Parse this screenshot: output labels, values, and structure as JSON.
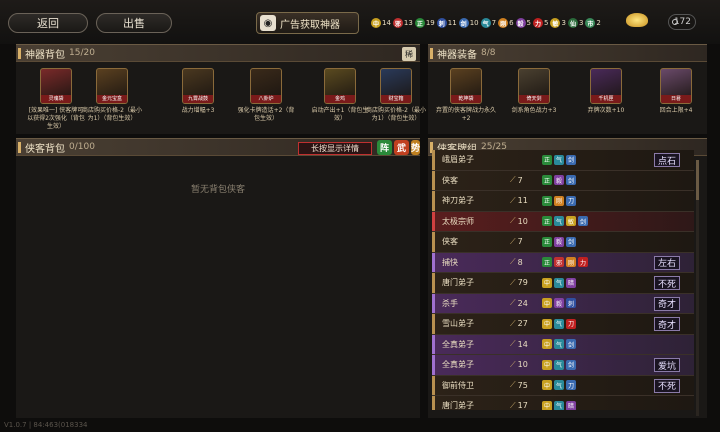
{
  "topbar": {
    "back_label": "返回",
    "sell_label": "出售",
    "ad_label": "广告获取神器",
    "time": "172",
    "resources": [
      {
        "icon": "中",
        "color": "#c8a020",
        "value": "14"
      },
      {
        "icon": "邪",
        "color": "#c03030",
        "value": "13"
      },
      {
        "icon": "正",
        "color": "#2a8a3a",
        "value": "19"
      },
      {
        "icon": "刺",
        "color": "#3050a0",
        "value": "11"
      },
      {
        "icon": "剑",
        "color": "#3a6ab0",
        "value": "10"
      },
      {
        "icon": "气",
        "color": "#2a8a9a",
        "value": "7"
      },
      {
        "icon": "刚",
        "color": "#d08020",
        "value": "6"
      },
      {
        "icon": "毅",
        "color": "#8040a0",
        "value": "5"
      },
      {
        "icon": "力",
        "color": "#c02020",
        "value": "5"
      },
      {
        "icon": "敏",
        "color": "#c8a020",
        "value": "3"
      },
      {
        "icon": "仙",
        "color": "#2a6a3a",
        "value": "3"
      },
      {
        "icon": "市",
        "color": "#3a8a5a",
        "value": "2"
      }
    ]
  },
  "bag": {
    "title": "神器背包",
    "count": "15/20",
    "badge": "稀",
    "items": [
      {
        "name": "灵魂袋",
        "desc": "[效果唯一] 侠客牌可以获得2次强化（背包生效）",
        "color": "#7a2a2a"
      },
      {
        "name": "金元宝盒",
        "desc": "商店购买价格-2（最小为1）（背包生效）",
        "color": "#5a4020"
      },
      {
        "name": "九霄战鼓",
        "desc": "战力增幅+3",
        "color": "#4a3820"
      },
      {
        "name": "八卦炉",
        "desc": "强化卡牌造话+2（背包生效）",
        "color": "#3a2a1a"
      },
      {
        "name": "金鸡",
        "desc": "启动产出+1（背包生效）",
        "color": "#5a4a20"
      },
      {
        "name": "财宝箱",
        "desc": "商店购买价格-2（最小为1）（背包生效）",
        "color": "#2a3a5a"
      }
    ]
  },
  "equip": {
    "title": "神器装备",
    "count": "8/8",
    "items": [
      {
        "name": "乾坤袋",
        "desc": "弃置的侠客牌战力永久+2",
        "color": "#5a4020"
      },
      {
        "name": "倚天剑",
        "desc": "剑系角色战力+3",
        "color": "#4a4030"
      },
      {
        "name": "千机匣",
        "desc": "弃牌次数+10",
        "color": "#4a2a5a"
      },
      {
        "name": "日晷",
        "desc": "回合上限+4",
        "color": "#6a4a6a"
      }
    ]
  },
  "hero_bag": {
    "title": "侠客背包",
    "count": "0/100",
    "detail_label": "长按显示详情",
    "sorts": [
      {
        "label": "阵",
        "color": "#2a8a3a"
      },
      {
        "label": "武",
        "color": "#c04020"
      },
      {
        "label": "势",
        "color": "#c08020"
      }
    ],
    "empty_text": "暂无背包侠客"
  },
  "deck": {
    "title": "侠客牌组",
    "count": "25/25",
    "rows": [
      {
        "name": "峨眉弟子",
        "atk": "",
        "style": "",
        "tags": [
          {
            "t": "正",
            "c": "#2a8a3a"
          },
          {
            "t": "气",
            "c": "#2a8a9a"
          },
          {
            "t": "剑",
            "c": "#3a6ab0"
          }
        ],
        "mark": "点石"
      },
      {
        "name": "侠客",
        "atk": "7",
        "style": "",
        "tags": [
          {
            "t": "正",
            "c": "#2a8a3a"
          },
          {
            "t": "毅",
            "c": "#8040a0"
          },
          {
            "t": "剑",
            "c": "#3a6ab0"
          }
        ],
        "mark": ""
      },
      {
        "name": "神刀弟子",
        "atk": "11",
        "style": "",
        "tags": [
          {
            "t": "正",
            "c": "#2a8a3a"
          },
          {
            "t": "刚",
            "c": "#d08020"
          },
          {
            "t": "刀",
            "c": "#3a6ab0"
          }
        ],
        "mark": ""
      },
      {
        "name": "太极宗师",
        "atk": "10",
        "style": "red",
        "tags": [
          {
            "t": "正",
            "c": "#2a8a3a"
          },
          {
            "t": "气",
            "c": "#2a8a9a"
          },
          {
            "t": "敏",
            "c": "#c8a020"
          },
          {
            "t": "剑",
            "c": "#3a6ab0"
          }
        ],
        "mark": ""
      },
      {
        "name": "侠客",
        "atk": "7",
        "style": "",
        "tags": [
          {
            "t": "正",
            "c": "#2a8a3a"
          },
          {
            "t": "毅",
            "c": "#8040a0"
          },
          {
            "t": "剑",
            "c": "#3a6ab0"
          }
        ],
        "mark": ""
      },
      {
        "name": "捕快",
        "atk": "8",
        "style": "purple",
        "tags": [
          {
            "t": "正",
            "c": "#2a8a3a"
          },
          {
            "t": "邪",
            "c": "#c03030"
          },
          {
            "t": "刚",
            "c": "#d08020"
          },
          {
            "t": "力",
            "c": "#c02020"
          }
        ],
        "mark": "左右"
      },
      {
        "name": "唐门弟子",
        "atk": "79",
        "style": "",
        "tags": [
          {
            "t": "中",
            "c": "#c8a020"
          },
          {
            "t": "气",
            "c": "#2a8a9a"
          },
          {
            "t": "暗",
            "c": "#8040a0"
          }
        ],
        "mark": "不死"
      },
      {
        "name": "杀手",
        "atk": "24",
        "style": "purple",
        "tags": [
          {
            "t": "中",
            "c": "#c8a020"
          },
          {
            "t": "毅",
            "c": "#8040a0"
          },
          {
            "t": "刺",
            "c": "#3050a0"
          }
        ],
        "mark": "奇才"
      },
      {
        "name": "雪山弟子",
        "atk": "27",
        "style": "",
        "tags": [
          {
            "t": "中",
            "c": "#c8a020"
          },
          {
            "t": "气",
            "c": "#2a8a9a"
          },
          {
            "t": "刀",
            "c": "#c02020"
          }
        ],
        "mark": "奇才"
      },
      {
        "name": "全真弟子",
        "atk": "14",
        "style": "purple",
        "tags": [
          {
            "t": "中",
            "c": "#c8a020"
          },
          {
            "t": "气",
            "c": "#2a8a9a"
          },
          {
            "t": "剑",
            "c": "#3a6ab0"
          }
        ],
        "mark": ""
      },
      {
        "name": "全真弟子",
        "atk": "10",
        "style": "purple",
        "tags": [
          {
            "t": "中",
            "c": "#c8a020"
          },
          {
            "t": "气",
            "c": "#2a8a9a"
          },
          {
            "t": "剑",
            "c": "#3a6ab0"
          }
        ],
        "mark": "爱坑"
      },
      {
        "name": "御前侍卫",
        "atk": "75",
        "style": "",
        "tags": [
          {
            "t": "中",
            "c": "#c8a020"
          },
          {
            "t": "气",
            "c": "#2a8a9a"
          },
          {
            "t": "刀",
            "c": "#3a6ab0"
          }
        ],
        "mark": "不死"
      },
      {
        "name": "唐门弟子",
        "atk": "17",
        "style": "",
        "tags": [
          {
            "t": "中",
            "c": "#c8a020"
          },
          {
            "t": "气",
            "c": "#2a8a9a"
          },
          {
            "t": "暗",
            "c": "#8040a0"
          }
        ],
        "mark": ""
      }
    ]
  },
  "version": "V1.0.7 | 84:463(018334"
}
